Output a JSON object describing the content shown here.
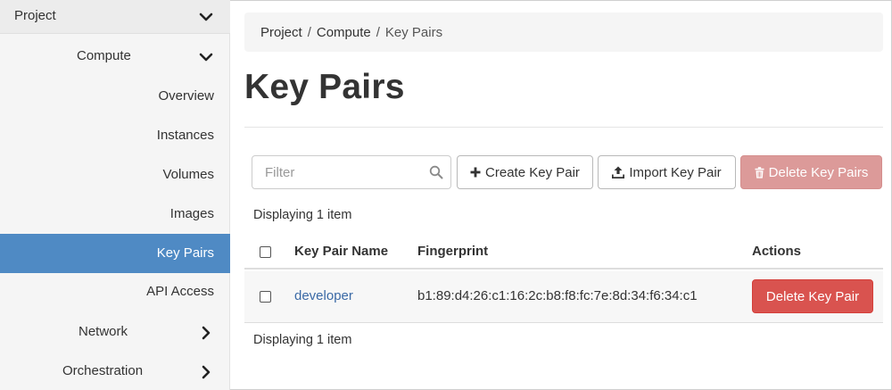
{
  "sidebar": {
    "project": "Project",
    "compute": "Compute",
    "items": [
      {
        "label": "Overview"
      },
      {
        "label": "Instances"
      },
      {
        "label": "Volumes"
      },
      {
        "label": "Images"
      },
      {
        "label": "Key Pairs",
        "active": true
      },
      {
        "label": "API Access"
      }
    ],
    "network": "Network",
    "orchestration": "Orchestration"
  },
  "breadcrumb": {
    "items": [
      "Project",
      "Compute",
      "Key Pairs"
    ],
    "separator": "/"
  },
  "page_title": "Key Pairs",
  "toolbar": {
    "filter_placeholder": "Filter",
    "create_label": "Create Key Pair",
    "import_label": "Import Key Pair",
    "delete_label": "Delete Key Pairs"
  },
  "table": {
    "summary_top": "Displaying 1 item",
    "summary_bottom": "Displaying 1 item",
    "columns": {
      "name": "Key Pair Name",
      "fingerprint": "Fingerprint",
      "actions": "Actions"
    },
    "rows": [
      {
        "name": "developer",
        "fingerprint": "b1:89:d4:26:c1:16:2c:b8:f8:fc:7e:8d:34:f6:34:c1",
        "action": "Delete Key Pair"
      }
    ]
  },
  "colors": {
    "sidebar_active": "#4f8ac4",
    "danger": "#d9534f",
    "danger_disabled": "#dc9a99",
    "link": "#3b6aa6"
  }
}
